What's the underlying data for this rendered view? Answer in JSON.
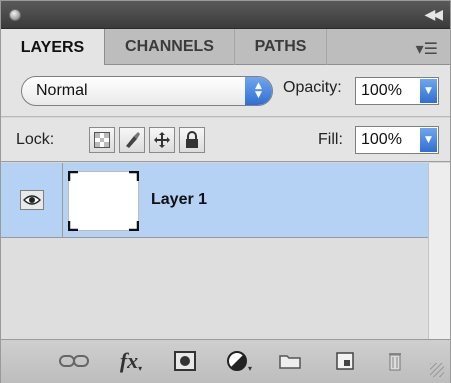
{
  "panel": {
    "tabs": [
      {
        "label": "LAYERS",
        "active": true
      },
      {
        "label": "CHANNELS",
        "active": false
      },
      {
        "label": "PATHS",
        "active": false
      }
    ]
  },
  "blend": {
    "mode": "Normal",
    "opacity_label": "Opacity:",
    "opacity_value": "100%"
  },
  "lock": {
    "label": "Lock:",
    "fill_label": "Fill:",
    "fill_value": "100%"
  },
  "layers": [
    {
      "name": "Layer 1",
      "visible": true,
      "selected": true
    }
  ],
  "colors": {
    "selection": "#b5d2f5",
    "accent_blue": "#2f6fd2"
  },
  "icons": {
    "title_collapse": "double-chevron-left-icon",
    "panel_menu": "panel-menu-icon",
    "lock_buttons": [
      "lock-transparent-pixels-icon",
      "lock-image-pixels-icon",
      "lock-position-icon",
      "lock-all-icon"
    ],
    "bottom_bar": [
      "link-layers-icon",
      "layer-style-fx-icon",
      "layer-mask-icon",
      "adjustment-layer-icon",
      "new-group-folder-icon",
      "new-layer-icon",
      "trash-icon"
    ]
  },
  "bottom_bar": {
    "fx_label": "fx"
  }
}
